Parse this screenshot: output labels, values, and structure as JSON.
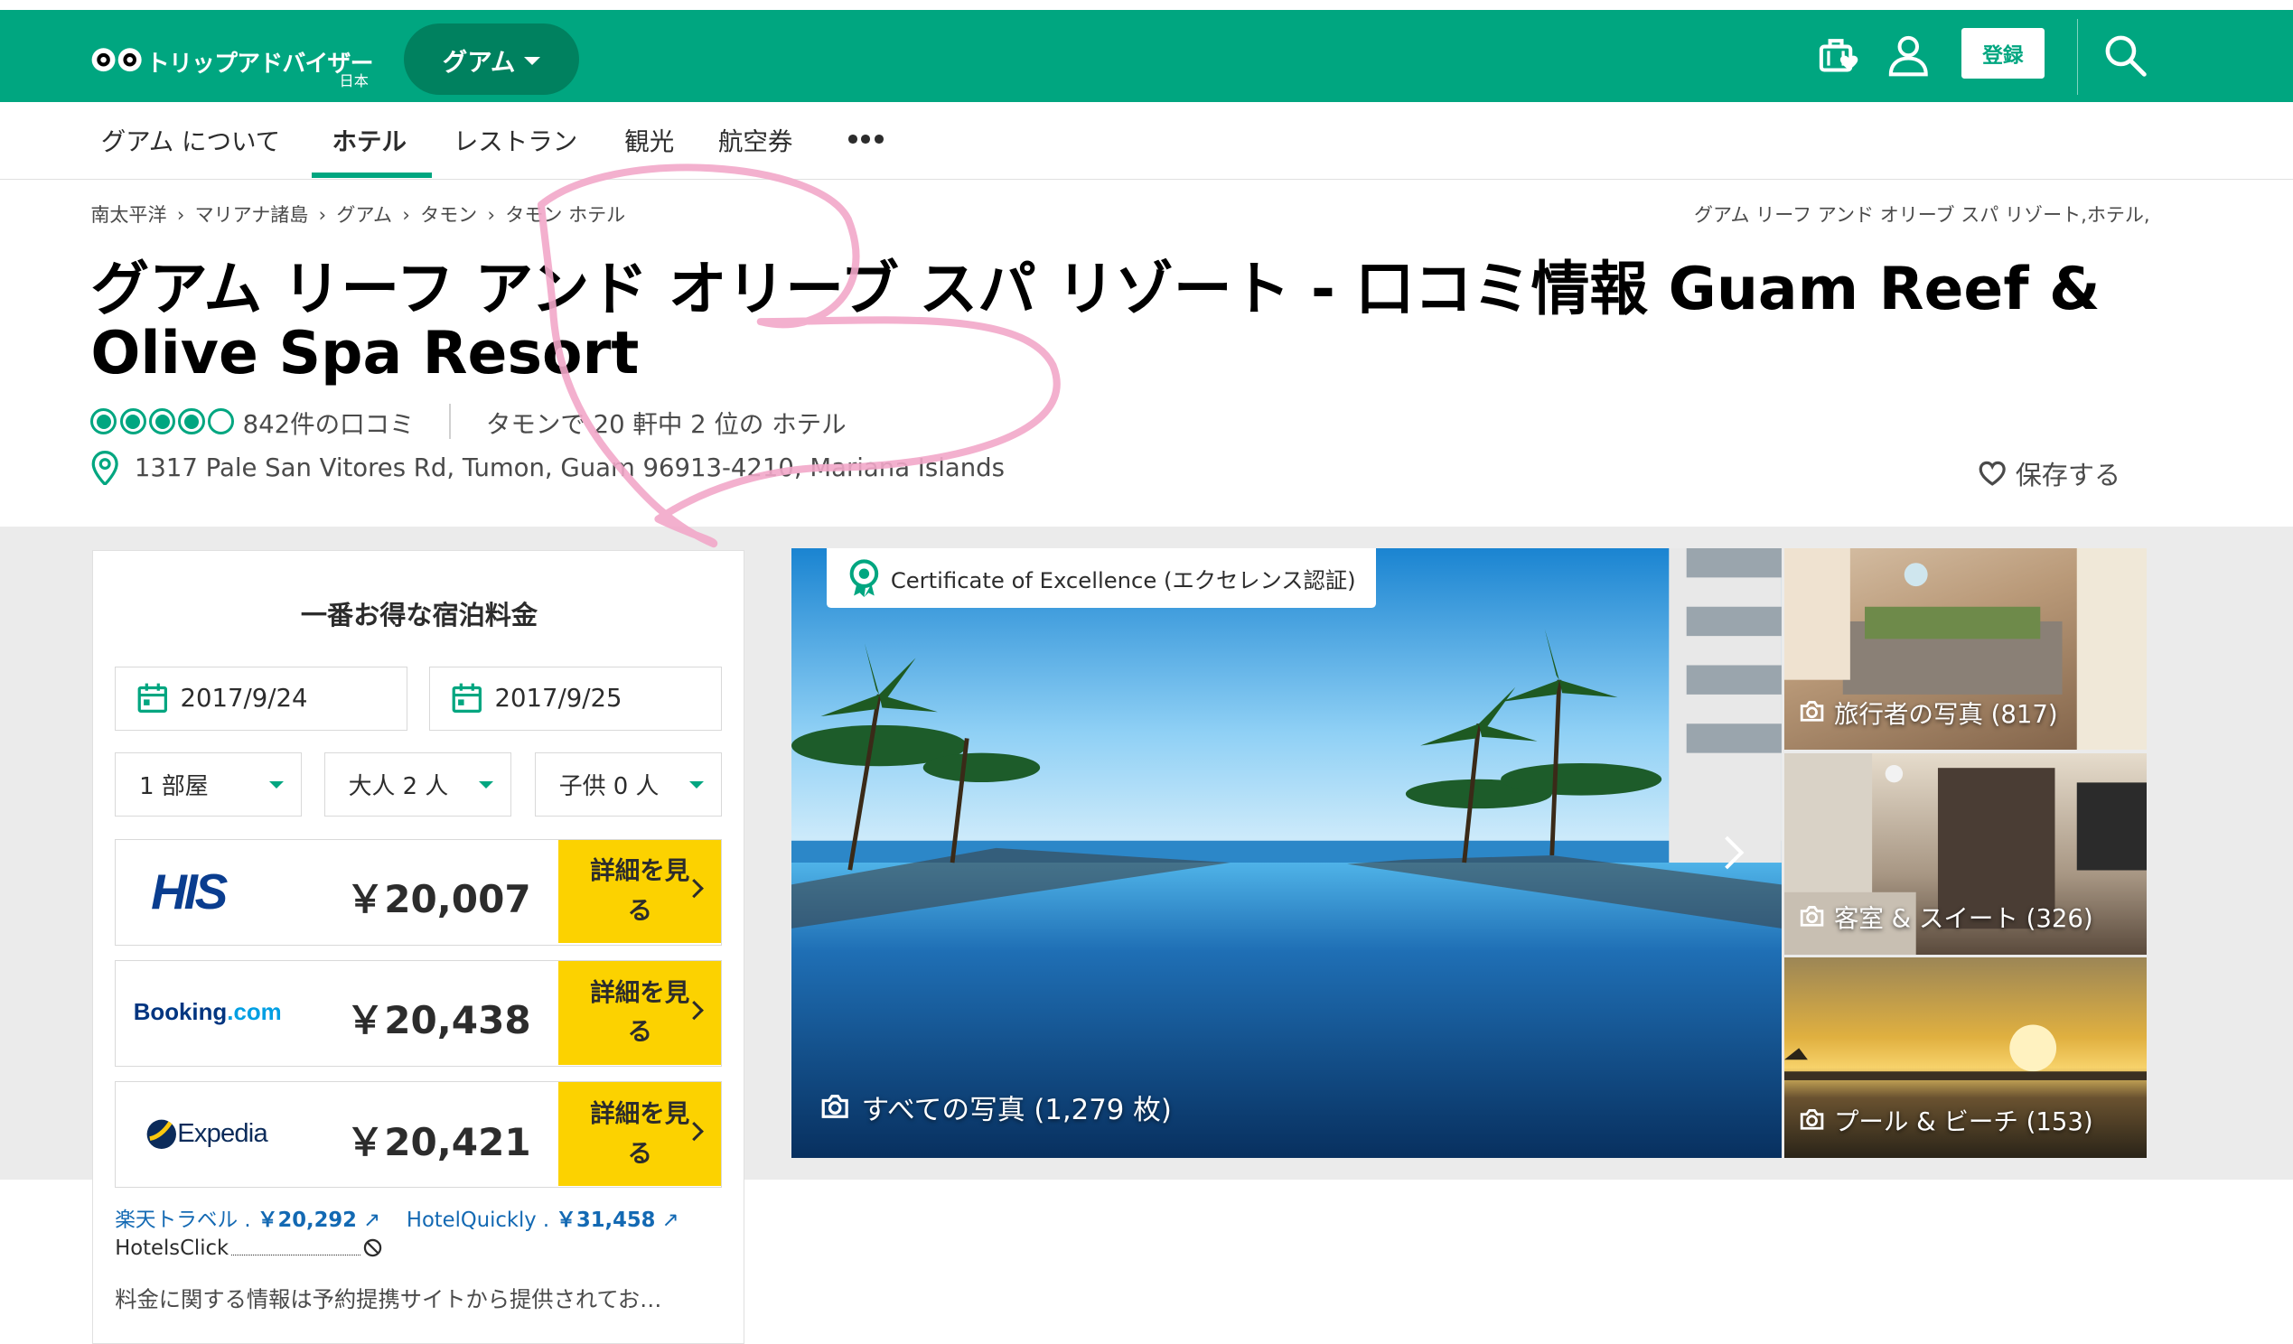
{
  "header": {
    "logo_text": "トリップアドバイザー",
    "logo_sub": "日本",
    "geo_button": "グアム",
    "register": "登録"
  },
  "nav": {
    "items": [
      "グアム について",
      "ホテル",
      "レストラン",
      "観光",
      "航空券"
    ],
    "active_index": 1
  },
  "breadcrumb": {
    "items": [
      "南太平洋",
      "マリアナ諸島",
      "グアム",
      "タモン",
      "タモン ホテル"
    ],
    "separator": "›",
    "right_text": "グアム リーフ アンド オリーブ スパ リゾート,ホテル,"
  },
  "hotel": {
    "title": "グアム リーフ アンド オリーブ スパ リゾート - 口コミ情報 Guam Reef & Olive Spa Resort",
    "rating": 4,
    "rating_max": 5,
    "reviews": "842件の口コミ",
    "rank": "タモンで 20 軒中 2 位の ホテル",
    "address": "1317 Pale San Vitores Rd, Tumon, Guam 96913-4210, Mariana Islands",
    "save": "保存する"
  },
  "booking": {
    "title": "一番お得な宿泊料金",
    "checkin": "2017/9/24",
    "checkout": "2017/9/25",
    "rooms": "1 部屋",
    "adults": "大人 2 人",
    "children": "子供 0 人",
    "offers": [
      {
        "provider": "HIS",
        "price": "￥20,007",
        "button": "詳細を見る"
      },
      {
        "provider": "Booking.com",
        "provider_main": "Booking",
        "provider_suffix": ".com",
        "price": "￥20,438",
        "button": "詳細を見る"
      },
      {
        "provider": "Expedia",
        "price": "￥20,421",
        "button": "詳細を見る"
      }
    ],
    "other1_name": "楽天トラベル",
    "other1_price": "￥20,292",
    "other2_name": "HotelQuickly",
    "other2_price": "￥31,458",
    "other3_name": "HotelsClick",
    "note": "料金に関する情報は予約提携サイトから提供されてお…"
  },
  "photos": {
    "certificate": "Certificate of Excellence (エクセレンス認証)",
    "all_photos": "すべての写真 (1,279 枚)",
    "thumbs": [
      {
        "label": "旅行者の写真 (817)"
      },
      {
        "label": "客室 & スイート (326)"
      },
      {
        "label": "プール & ビーチ (153)"
      }
    ]
  },
  "colors": {
    "brand": "#00a680",
    "deal_button": "#fcd200",
    "link": "#1369b3",
    "scribble": "#f2a7c9"
  }
}
